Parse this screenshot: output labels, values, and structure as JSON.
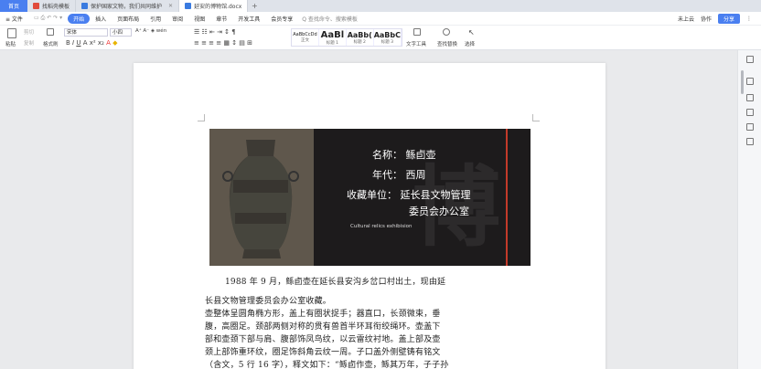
{
  "tabs": {
    "home": "首页",
    "items": [
      {
        "label": "找稻壳模板",
        "color": "#e14b3b"
      },
      {
        "label": "保护国家文物，我们共同维护",
        "color": "#3a7be0"
      },
      {
        "label": "延安的博物馆.docx",
        "color": "#3a7be0"
      }
    ],
    "add": "+"
  },
  "menu": {
    "file": "≡ 文件",
    "items": [
      "开始",
      "插入",
      "页面布局",
      "引用",
      "审阅",
      "视图",
      "章节",
      "开发工具",
      "会员专享"
    ],
    "active_index": 0,
    "search": "Q 查找命令、搜索模板",
    "right": [
      "未上云",
      "协作",
      "分享"
    ]
  },
  "ribbon": {
    "paste": "粘贴",
    "cut": "剪切",
    "copy": "复制",
    "format_painter": "格式刷",
    "font_name": "宋体",
    "font_size": "小四",
    "styles": [
      {
        "sample": "AaBbCcDd",
        "name": "正文"
      },
      {
        "sample": "AaBl",
        "name": "标题 1"
      },
      {
        "sample": "AaBb(",
        "name": "标题 2"
      },
      {
        "sample": "AaBbC",
        "name": "标题 3"
      }
    ],
    "text_tool": "文字工具",
    "find_replace": "查找替换",
    "select": "选择"
  },
  "document": {
    "banner": {
      "name_line": "名称：  鲧卣壶",
      "era_line": "年代：  西周",
      "owner_line": "收藏单位：  延长县文物管理",
      "owner_line2": "委员会办公室",
      "subtitle": "Cultural relics exhibision",
      "watermark": "博"
    },
    "paragraphs": [
      "1988 年 9 月，鲧卣壶在延长县安沟乡岔口村出土，现由延",
      "长县文物管理委员会办公室收藏。",
      "壶整体呈圆角椭方形，盖上有圈状捉手；器直口，长颈微束，垂",
      "腹，高圈足。颈部两侧对称的贯有兽首半环耳衔绞绳环。壶盖下",
      "部和壶颈下部与肩、腹部饰凤鸟纹，以云雷纹衬地。盖上部及壶",
      "颈上部饰重环纹，圈足饰斜角云纹一周。子口盖外侧壁铸有铭文",
      "（含文，5 行 16 字），释文如下：“鲧卣作壶，鲧其万年，子子孙"
    ]
  }
}
